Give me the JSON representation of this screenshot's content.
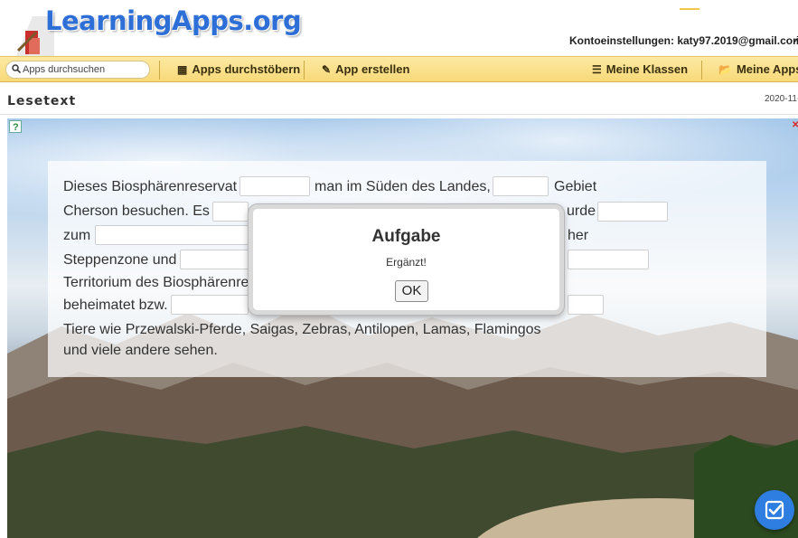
{
  "header": {
    "logo_text": "LearningApps.org",
    "account_label": "Kontoeinstellungen: katy97.2019@gmail.com"
  },
  "nav": {
    "search_placeholder": "Apps durchsuchen",
    "browse": "Apps durchstöbern",
    "create": "App erstellen",
    "classes": "Meine Klassen",
    "my_apps": "Meine Apps"
  },
  "page": {
    "title": "Lesetext",
    "date": "2020-11-"
  },
  "exercise": {
    "lines": [
      [
        "Dieses Biosphärenreservat",
        "man im Süden des Landes,",
        "Gebiet"
      ],
      [
        "Cherson besuchen. Es",
        "urde"
      ],
      [
        "zum",
        "her"
      ],
      [
        "Steppenzone und"
      ],
      [
        "Territorium des Biosphärenre"
      ],
      [
        "beheimatet bzw."
      ],
      [
        "Tiere wie Przewalski-Pferde, Saigas, Zebras, Antilopen, Lamas, Flamingos"
      ],
      [
        "und viele andere sehen."
      ]
    ]
  },
  "modal": {
    "title": "Aufgabe",
    "message": "Ergänzt!",
    "ok_label": "OK"
  },
  "icons": {
    "search": "search-icon",
    "browse": "grid-icon",
    "create": "pencil-icon",
    "classes": "list-icon",
    "my_apps": "folder-icon",
    "help": "help-icon",
    "check": "check-icon"
  },
  "colors": {
    "nav_bg": "#f8d979",
    "logo_blue": "#2d6fd6",
    "fab_blue": "#2e7de0"
  }
}
